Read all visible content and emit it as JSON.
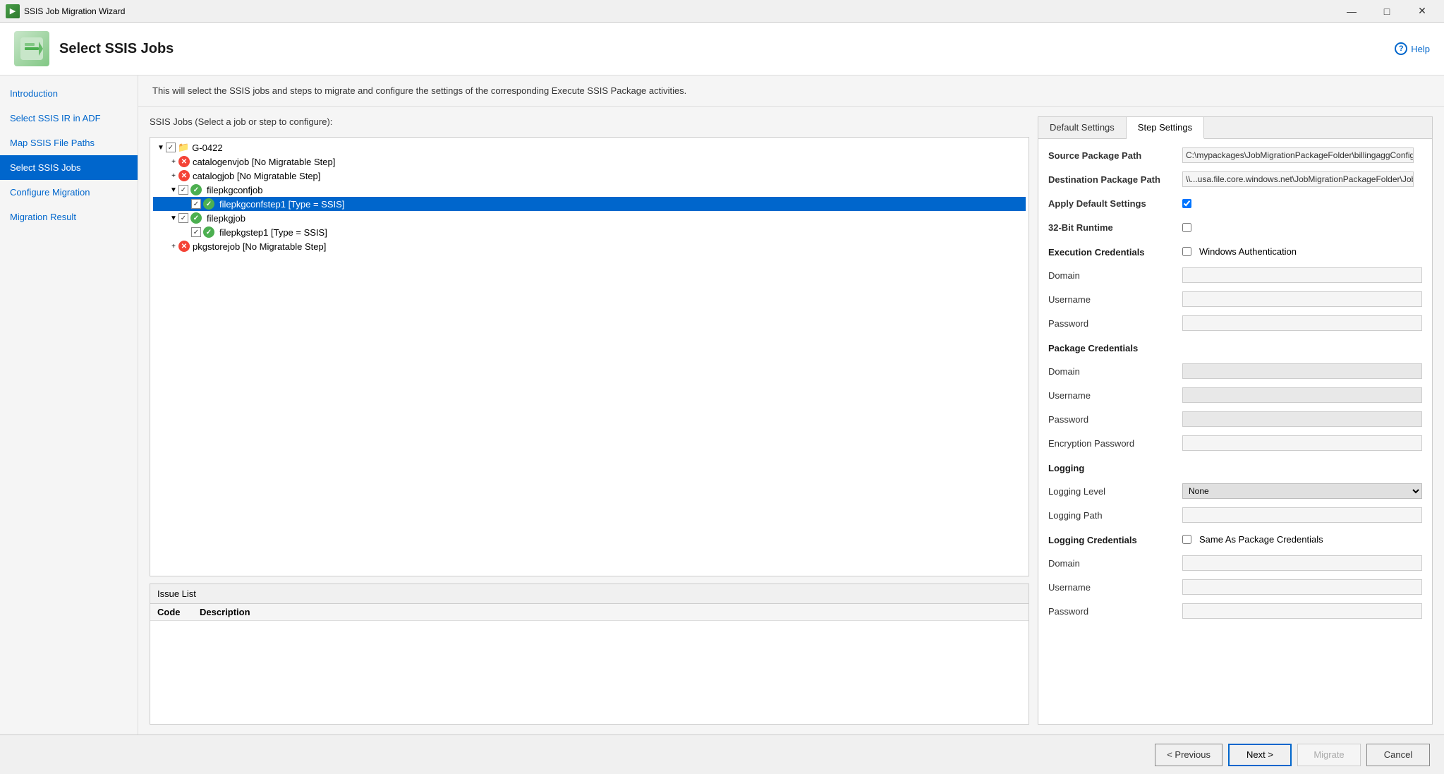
{
  "titlebar": {
    "title": "SSIS Job Migration Wizard",
    "icon": "🔷"
  },
  "header": {
    "title": "Select SSIS Jobs",
    "icon": "📦"
  },
  "description": "This will select the SSIS jobs and steps to migrate and configure the settings of the corresponding Execute SSIS Package activities.",
  "sidebar": {
    "items": [
      {
        "id": "introduction",
        "label": "Introduction",
        "state": "link"
      },
      {
        "id": "select-ssis-ir",
        "label": "Select SSIS IR in ADF",
        "state": "link"
      },
      {
        "id": "map-ssis-file",
        "label": "Map SSIS File Paths",
        "state": "link"
      },
      {
        "id": "select-ssis-jobs",
        "label": "Select SSIS Jobs",
        "state": "active"
      },
      {
        "id": "configure-migration",
        "label": "Configure Migration",
        "state": "link"
      },
      {
        "id": "migration-result",
        "label": "Migration Result",
        "state": "link"
      }
    ]
  },
  "jobs_section": {
    "label": "SSIS Jobs (Select a job or step to configure):",
    "tree": [
      {
        "id": "root",
        "indent": 0,
        "toggle": "▼",
        "checkbox": true,
        "checked": true,
        "icon": "folder",
        "iconType": null,
        "text": "G-0422",
        "selected": false
      },
      {
        "id": "catalogenvjob",
        "indent": 1,
        "toggle": "+",
        "checkbox": false,
        "checked": false,
        "icon": "error",
        "iconType": "error",
        "text": "catalogenvjob [No Migratable Step]",
        "selected": false
      },
      {
        "id": "catalogjob",
        "indent": 1,
        "toggle": "+",
        "checkbox": false,
        "checked": false,
        "icon": "error",
        "iconType": "error",
        "text": "catalogjob [No Migratable Step]",
        "selected": false
      },
      {
        "id": "filepkgconfjob",
        "indent": 1,
        "toggle": "▼",
        "checkbox": true,
        "checked": true,
        "icon": "folder",
        "iconType": null,
        "text": "filepkgconfjob",
        "selected": false
      },
      {
        "id": "filepkgconfstep1",
        "indent": 2,
        "toggle": " ",
        "checkbox": true,
        "checked": true,
        "icon": "success",
        "iconType": "success",
        "text": "filepkgconfstep1 [Type = SSIS]",
        "selected": true
      },
      {
        "id": "filepkgjob",
        "indent": 1,
        "toggle": "▼",
        "checkbox": true,
        "checked": true,
        "icon": "folder",
        "iconType": null,
        "text": "filepkgjob",
        "selected": false
      },
      {
        "id": "filepkgstep1",
        "indent": 2,
        "toggle": " ",
        "checkbox": true,
        "checked": true,
        "icon": "success",
        "iconType": "success",
        "text": "filepkgstep1 [Type = SSIS]",
        "selected": false
      },
      {
        "id": "pkgstorejob",
        "indent": 1,
        "toggle": "+",
        "checkbox": false,
        "checked": false,
        "icon": "error",
        "iconType": "error",
        "text": "pkgstorejob [No Migratable Step]",
        "selected": false
      }
    ]
  },
  "issue_list": {
    "header": "Issue List",
    "columns": [
      "Code",
      "Description"
    ]
  },
  "settings": {
    "tabs": [
      {
        "id": "default-settings",
        "label": "Default Settings"
      },
      {
        "id": "step-settings",
        "label": "Step Settings"
      }
    ],
    "active_tab": "step-settings",
    "fields": {
      "source_package_path_label": "Source Package Path",
      "source_package_path_value": "C:\\mypackages\\JobMigrationPackageFolder\\billingaggConfig.dtsx",
      "destination_package_path_label": "Destination Package Path",
      "destination_package_path_value": "\\\\...usa.file.core.windows.net\\JobMigrationPackageFolder\\JobMigra",
      "apply_default_settings_label": "Apply Default Settings",
      "apply_default_settings_checked": true,
      "bit32_runtime_label": "32-Bit Runtime",
      "bit32_runtime_checked": false,
      "execution_credentials_label": "Execution Credentials",
      "windows_auth_label": "Windows Authentication",
      "windows_auth_checked": false,
      "domain_label": "Domain",
      "username_label": "Username",
      "password_label": "Password",
      "package_credentials_label": "Package Credentials",
      "pkg_domain_label": "Domain",
      "pkg_username_label": "Username",
      "pkg_password_label": "Password",
      "encryption_password_label": "Encryption Password",
      "logging_label": "Logging",
      "logging_level_label": "Logging Level",
      "logging_level_value": "None",
      "logging_path_label": "Logging Path",
      "logging_credentials_label": "Logging Credentials",
      "same_as_pkg_label": "Same As Package Credentials",
      "same_as_pkg_checked": false,
      "log_domain_label": "Domain",
      "log_username_label": "Username",
      "log_password_label": "Password"
    }
  },
  "footer": {
    "previous_label": "< Previous",
    "next_label": "Next >",
    "migrate_label": "Migrate",
    "cancel_label": "Cancel"
  },
  "help": {
    "label": "Help"
  }
}
